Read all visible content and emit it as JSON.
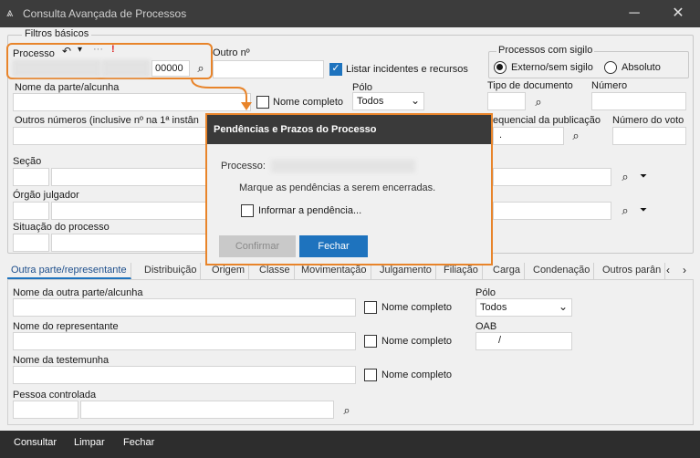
{
  "window": {
    "title": "Consulta Avançada de Processos",
    "minimize_glyph": "─",
    "close_glyph": "✕"
  },
  "filters": {
    "section_label": "Filtros básicos",
    "processo_label": "Processo",
    "processo_value": "00000",
    "outro_label": "Outro nº",
    "listar_label": "Listar incidentes e recursos",
    "listar_checked": true,
    "sigilo_group_label": "Processos com sigilo",
    "sigilo_options": [
      "Externo/sem sigilo",
      "Absoluto"
    ],
    "sigilo_selected": "Externo/sem sigilo",
    "nome_parte_label": "Nome da parte/alcunha",
    "nome_completo_label": "Nome completo",
    "polo_label": "Pólo",
    "polo_value": "Todos",
    "tipo_doc_label": "Tipo de documento",
    "numero_label": "Número",
    "outros_numeros_label": "Outros números  (inclusive nº na 1ª instân",
    "seq_pub_label": "equencial da publicação",
    "seq_pub_value": ".",
    "numero_voto_label": "Número do voto",
    "secao_label": "Seção",
    "orgao_label": "Órgão julgador",
    "situacao_label": "Situação do processo"
  },
  "tabs": [
    "Outra parte/representante",
    "Distribuição",
    "Origem",
    "Classe",
    "Movimentação",
    "Julgamento",
    "Filiação",
    "Carga",
    "Condenação",
    "Outros parân"
  ],
  "tabs_active": "Outra parte/representante",
  "lower": {
    "outra_parte_label": "Nome da outra parte/alcunha",
    "nome_completo_label": "Nome completo",
    "polo_label": "Pólo",
    "polo_value": "Todos",
    "representante_label": "Nome do representante",
    "oab_label": "OAB",
    "oab_value": "/",
    "testemunha_label": "Nome da testemunha",
    "pessoa_label": "Pessoa controlada"
  },
  "bottom": {
    "consultar": "Consultar",
    "limpar": "Limpar",
    "fechar": "Fechar"
  },
  "modal": {
    "title": "Pendências e Prazos do Processo",
    "processo_label": "Processo:",
    "instruction": "Marque as pendências a serem encerradas.",
    "informar_label": "Informar a pendência...",
    "confirmar": "Confirmar",
    "fechar": "Fechar"
  },
  "colors": {
    "accent": "#e8842a",
    "primary": "#1e73be",
    "titlebar": "#3c3c3c",
    "bottombar": "#2d2d2d"
  }
}
